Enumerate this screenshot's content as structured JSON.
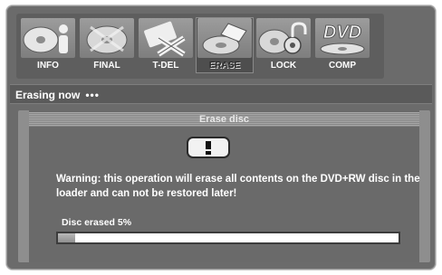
{
  "menu": {
    "items": [
      {
        "label": "INFO",
        "icon": "disc-info-icon",
        "selected": false
      },
      {
        "label": "FINAL",
        "icon": "disc-finalize-icon",
        "selected": false
      },
      {
        "label": "T-DEL",
        "icon": "title-delete-icon",
        "selected": false
      },
      {
        "label": "ERASE",
        "icon": "disc-erase-icon",
        "selected": true
      },
      {
        "label": "LOCK",
        "icon": "disc-lock-icon",
        "selected": false
      },
      {
        "label": "COMP",
        "icon": "dvd-compatibility-icon",
        "selected": false
      }
    ]
  },
  "status": {
    "text": "Erasing now",
    "dots": "•••"
  },
  "dialog": {
    "title": "Erase disc",
    "warning_icon": "exclamation-icon",
    "warning": "Warning: this operation will erase all contents on the DVD+RW disc in the loader and can not be restored later!",
    "progress_label": "Disc erased 5%",
    "progress_percent": 5
  }
}
